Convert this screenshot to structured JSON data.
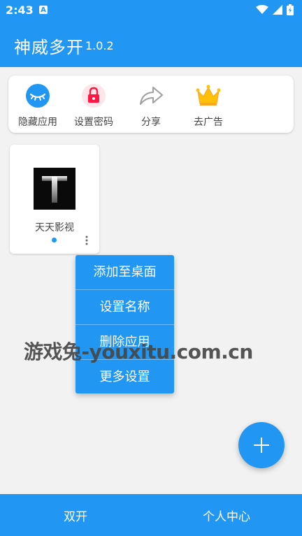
{
  "status": {
    "time": "2:43",
    "indicator": "A"
  },
  "app": {
    "title": "神威多开",
    "version": "1.0.2"
  },
  "tools": [
    {
      "label": "隐藏应用",
      "icon": "eye-closed-icon"
    },
    {
      "label": "设置密码",
      "icon": "lock-icon"
    },
    {
      "label": "分享",
      "icon": "share-icon"
    },
    {
      "label": "去广告",
      "icon": "crown-icon"
    }
  ],
  "tile": {
    "name": "天天影视",
    "icon_letter": "T"
  },
  "menu": {
    "items": [
      "添加至桌面",
      "设置名称",
      "删除应用",
      "更多设置"
    ]
  },
  "watermark": "游戏兔-youxitu.com.cn",
  "fab": {
    "icon": "plus-icon"
  },
  "bottom_nav": {
    "left": "双开",
    "right": "个人中心"
  },
  "colors": {
    "primary": "#2196f3",
    "background": "#f2f2f2"
  }
}
